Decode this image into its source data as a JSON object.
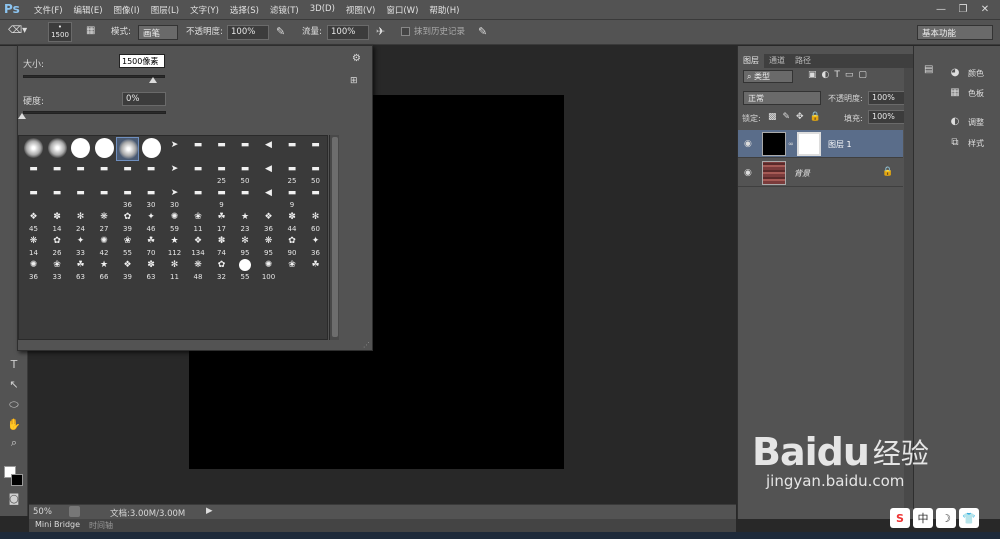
{
  "app": {
    "logo": "Ps"
  },
  "menu": [
    "文件(F)",
    "编辑(E)",
    "图像(I)",
    "图层(L)",
    "文字(Y)",
    "选择(S)",
    "滤镜(T)",
    "3D(D)",
    "视图(V)",
    "窗口(W)",
    "帮助(H)"
  ],
  "window_controls": {
    "minimize": "—",
    "restore": "❐",
    "close": "✕"
  },
  "options": {
    "brush_size": "1500",
    "mode_label": "模式:",
    "mode_value": "画笔",
    "opacity_label": "不透明度:",
    "opacity_value": "100%",
    "flow_label": "流量:",
    "flow_value": "100%",
    "history_label": "抹到历史记录",
    "workspace": "基本功能"
  },
  "brush_panel": {
    "size_label": "大小:",
    "size_value": "1500",
    "size_unit": "像素",
    "size_fraction": 0.95,
    "hardness_label": "硬度:",
    "hardness_value": "0%",
    "hardness_fraction": 0.0,
    "presets": [
      [
        "",
        "",
        "",
        "",
        "",
        "",
        "",
        "",
        "",
        "",
        "",
        "",
        ""
      ],
      [
        "",
        "",
        "",
        "",
        "",
        "",
        "",
        "",
        "25",
        "50",
        "",
        "25",
        "50"
      ],
      [
        "",
        "",
        "",
        "",
        "36",
        "30",
        "30",
        "",
        "9",
        "",
        "",
        "9",
        ""
      ],
      [
        "45",
        "14",
        "24",
        "27",
        "39",
        "46",
        "59",
        "11",
        "17",
        "23",
        "36",
        "44",
        "60"
      ],
      [
        "14",
        "26",
        "33",
        "42",
        "55",
        "70",
        "112",
        "134",
        "74",
        "95",
        "95",
        "90",
        "36"
      ],
      [
        "36",
        "33",
        "63",
        "66",
        "39",
        "63",
        "11",
        "48",
        "32",
        "55",
        "100",
        "",
        ""
      ]
    ]
  },
  "status": {
    "zoom": "50%",
    "doc": "文档:3.00M/3.00M"
  },
  "bottom_tabs": [
    "Mini Bridge",
    "时间轴"
  ],
  "layers_panel": {
    "tabs": [
      "图层",
      "通道",
      "路径"
    ],
    "filter_kind": "类型",
    "blend_mode": "正常",
    "opacity_label": "不透明度:",
    "opacity_value": "100%",
    "lock_label": "锁定:",
    "fill_label": "填充:",
    "fill_value": "100%",
    "layers": [
      {
        "name": "图层 1",
        "selected": true
      },
      {
        "name": "背景",
        "selected": false
      }
    ]
  },
  "dock": {
    "items": [
      "颜色",
      "色板",
      "调整",
      "样式"
    ],
    "icons": [
      "palette-icon",
      "swatches-icon",
      "adjust-icon",
      "styles-icon"
    ]
  },
  "watermark": {
    "brand": "Baidu",
    "cn": "经验",
    "url": "jingyan.baidu.com"
  },
  "ime": [
    "S",
    "中",
    "☽",
    "👕"
  ],
  "colors": {
    "chrome": "#535353",
    "dark": "#282828",
    "selected_layer": "#5a6d8a",
    "accent_blue": "#8cc4f0"
  }
}
